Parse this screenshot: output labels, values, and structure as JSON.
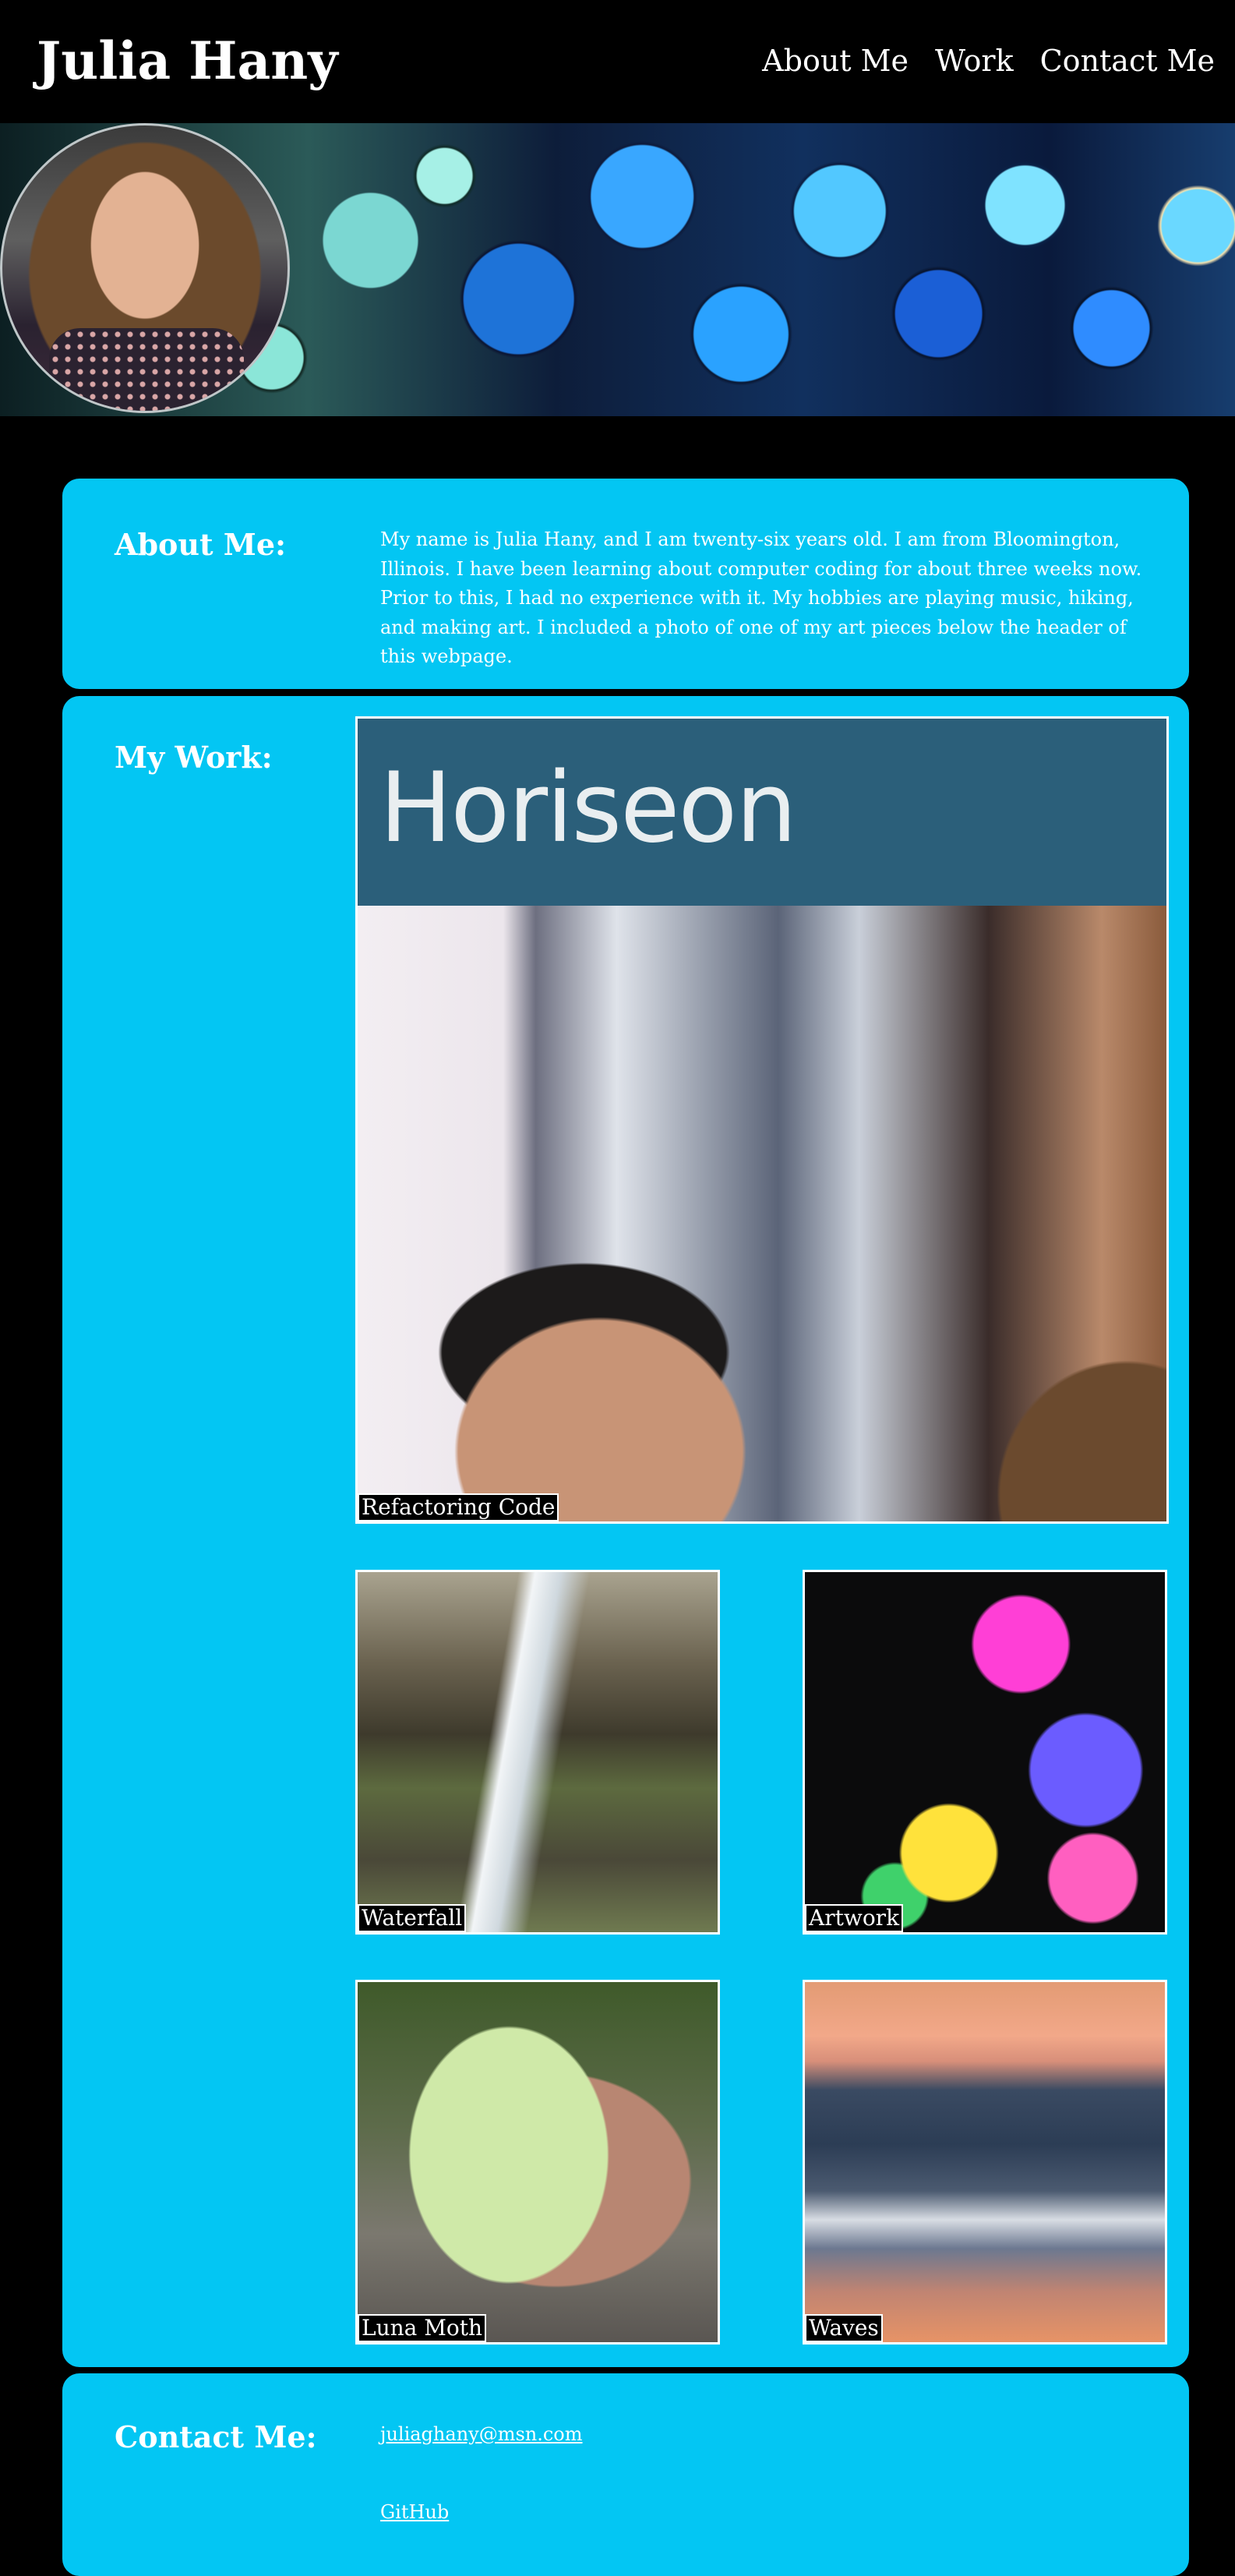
{
  "header": {
    "title": "Julia Hany",
    "nav": [
      {
        "label": "About Me"
      },
      {
        "label": "Work"
      },
      {
        "label": "Contact Me"
      }
    ]
  },
  "about": {
    "heading": "About Me:",
    "text": "My name is Julia Hany, and I am twenty-six years old. I am from Bloomington, Illinois. I have been learning about computer coding for about three weeks now. Prior to this, I had no experience with it. My hobbies are playing music, hiking, and making art. I included a photo of one of my art pieces below the header of this webpage."
  },
  "work": {
    "heading": "My Work:",
    "projects": [
      {
        "label": "Refactoring Code",
        "image_text": "Horiseon"
      },
      {
        "label": "Waterfall"
      },
      {
        "label": "Artwork"
      },
      {
        "label": "Luna Moth"
      },
      {
        "label": "Waves"
      }
    ]
  },
  "contact": {
    "heading": "Contact Me:",
    "email": "juliaghany@msn.com",
    "github": "GitHub"
  },
  "colors": {
    "background": "#000000",
    "section_background": "#03c6f3",
    "text": "#ffffff"
  }
}
